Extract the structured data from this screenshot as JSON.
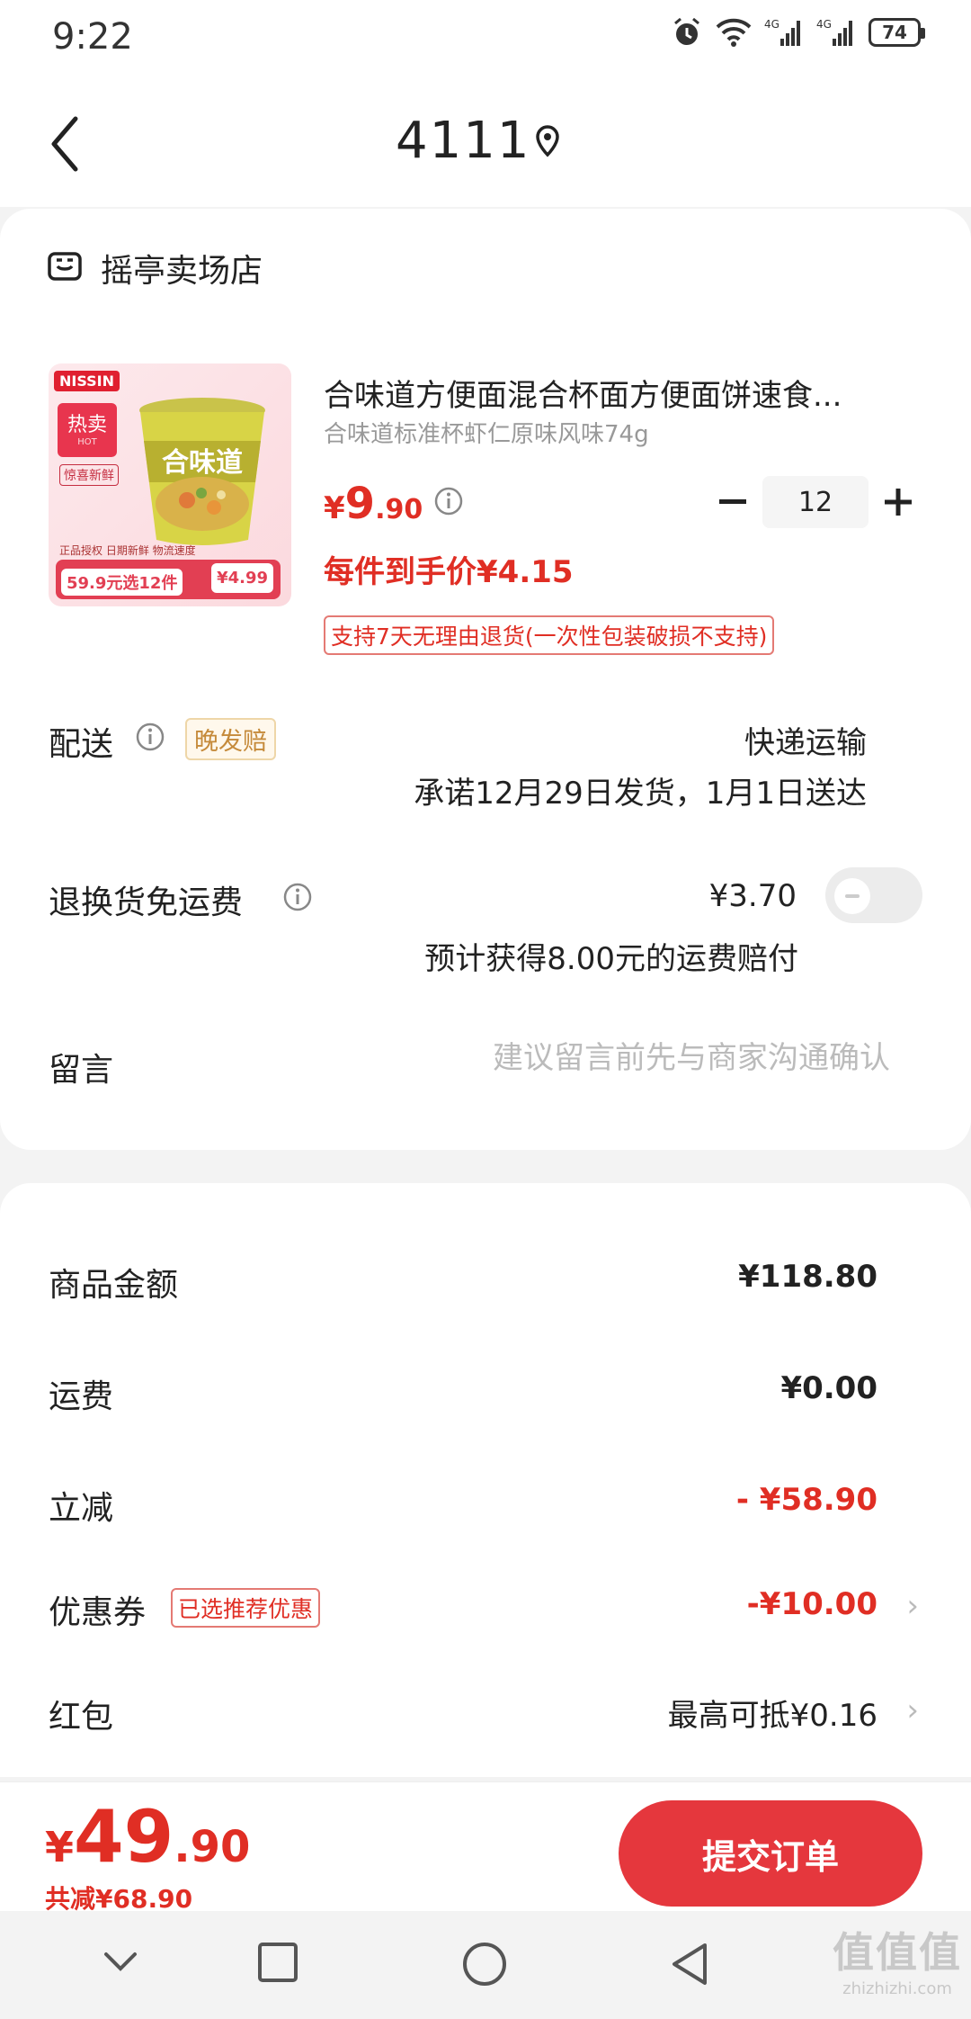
{
  "status_bar": {
    "time": "9:22",
    "battery": "74",
    "net1": "4G",
    "net2": "4G"
  },
  "header": {
    "title": "4111"
  },
  "shop": {
    "name": "摇亭卖场店"
  },
  "product": {
    "title": "合味道方便面混合杯面方便面饼速食...",
    "spec": "合味道标准杯虾仁原味风味74g",
    "price_yen": "¥",
    "price_int": "9",
    "price_dec": ".90",
    "quantity": "12",
    "unit_price": "每件到手价¥4.15",
    "return_policy": "支持7天无理由退货(一次性包装破损不支持)",
    "image": {
      "brand": "NISSIN",
      "hot": "热卖",
      "hot_sub": "HOT",
      "fresh": "惊喜新鲜",
      "cup_text": "合味道",
      "tagline": "正品授权 日期新鲜 物流速度",
      "promo_left": "59.9元选12件",
      "promo_right": "¥4.99"
    }
  },
  "delivery": {
    "label": "配送",
    "tag": "晚发赔",
    "method": "快递运输",
    "promise": "承诺12月29日发货，1月1日送达"
  },
  "return_shipping": {
    "label": "退换货免运费",
    "price": "¥3.70",
    "desc": "预计获得8.00元的运费赔付",
    "enabled": false
  },
  "message": {
    "label": "留言",
    "placeholder": "建议留言前先与商家沟通确认"
  },
  "summary": {
    "goods_label": "商品金额",
    "goods_value": "¥118.80",
    "shipping_label": "运费",
    "shipping_value": "¥0.00",
    "discount_label": "立减",
    "discount_value": "- ¥58.90",
    "coupon_label": "优惠券",
    "coupon_tag": "已选推荐优惠",
    "coupon_value": "-¥10.00",
    "redpacket_label": "红包",
    "redpacket_value": "最高可抵¥0.16",
    "chevron": "›"
  },
  "bottom": {
    "total_yen": "¥",
    "total_int": "49",
    "total_dec": ".90",
    "saved": "共减¥68.90",
    "submit": "提交订单"
  },
  "watermark": {
    "line1": "值值值",
    "line2": "zhizhizhi.com"
  },
  "colors": {
    "accent": "#e02e24",
    "button": "#e5373d",
    "background": "#f3f3f3"
  }
}
